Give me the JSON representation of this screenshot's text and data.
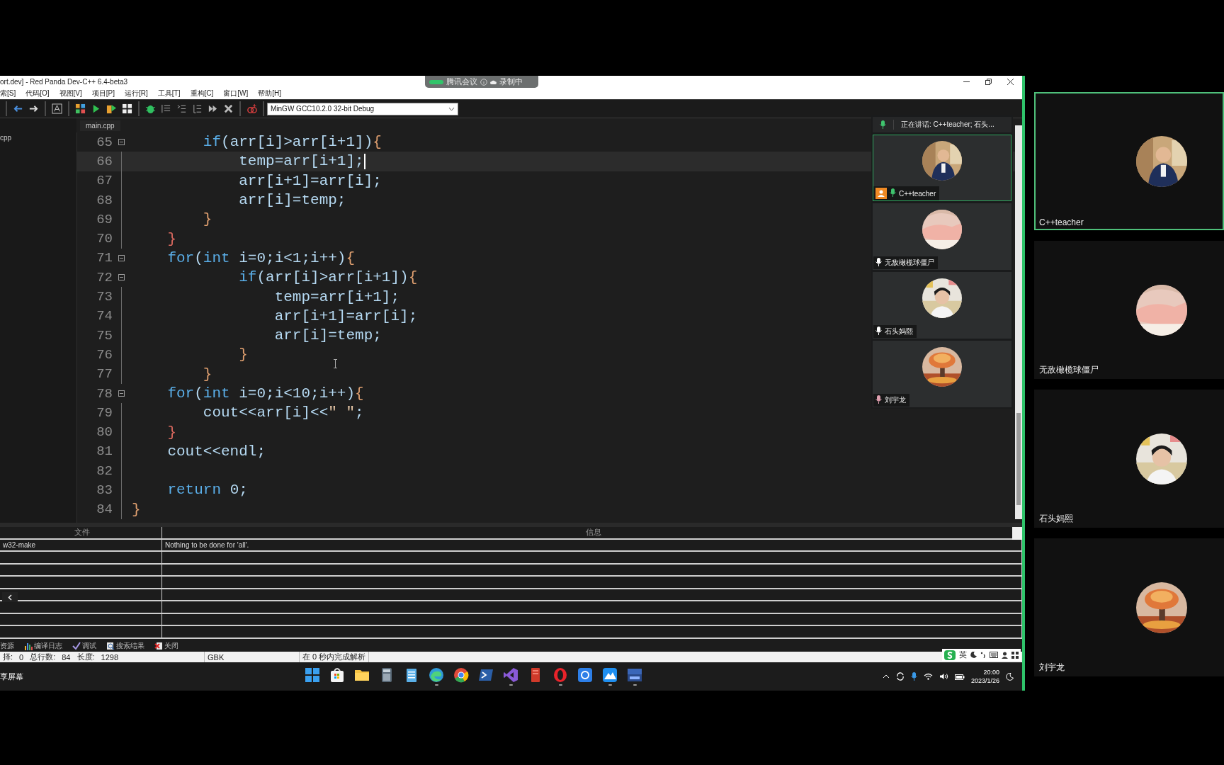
{
  "window": {
    "title": "ort.dev] - Red Panda Dev-C++ 6.4-beta3"
  },
  "recording_pill": {
    "app": "腾讯会议",
    "status": "录制中"
  },
  "menu": [
    "索[S]",
    "代码[O]",
    "视图[V]",
    "项目[P]",
    "运行[R]",
    "工具[T]",
    "重构[C]",
    "窗口[W]",
    "帮助[H]"
  ],
  "toolbar": {
    "compiler": "MinGW GCC10.2.0 32-bit Debug"
  },
  "project_panel": {
    "item": "cpp"
  },
  "editor": {
    "tab": "main.cpp",
    "lines": [
      {
        "number": "65",
        "fold": true,
        "current": false,
        "tokens": [
          {
            "kind": "kw",
            "text": "        if"
          },
          {
            "kind": "id",
            "text": "(arr[i]>arr[i+1])"
          },
          {
            "kind": "brace",
            "text": "{"
          }
        ]
      },
      {
        "number": "66",
        "fold": false,
        "current": true,
        "tokens": [
          {
            "kind": "id",
            "text": "            temp=arr[i+1];"
          }
        ]
      },
      {
        "number": "67",
        "fold": false,
        "current": false,
        "tokens": [
          {
            "kind": "id",
            "text": "            arr[i+1]=arr[i];"
          }
        ]
      },
      {
        "number": "68",
        "fold": false,
        "current": false,
        "tokens": [
          {
            "kind": "id",
            "text": "            arr[i]=temp;"
          }
        ]
      },
      {
        "number": "69",
        "fold": false,
        "current": false,
        "tokens": [
          {
            "kind": "brace",
            "text": "        }"
          }
        ]
      },
      {
        "number": "70",
        "fold": false,
        "current": false,
        "tokens": [
          {
            "kind": "brace2",
            "text": "    }"
          }
        ]
      },
      {
        "number": "71",
        "fold": true,
        "current": false,
        "tokens": [
          {
            "kind": "kw",
            "text": "    for"
          },
          {
            "kind": "id",
            "text": "("
          },
          {
            "kind": "kw",
            "text": "int"
          },
          {
            "kind": "id",
            "text": " i=0;i<1;i++)"
          },
          {
            "kind": "brace",
            "text": "{"
          }
        ]
      },
      {
        "number": "72",
        "fold": true,
        "current": false,
        "tokens": [
          {
            "kind": "kw",
            "text": "            if"
          },
          {
            "kind": "id",
            "text": "(arr[i]>arr[i+1])"
          },
          {
            "kind": "brace",
            "text": "{"
          }
        ]
      },
      {
        "number": "73",
        "fold": false,
        "current": false,
        "tokens": [
          {
            "kind": "id",
            "text": "                temp=arr[i+1];"
          }
        ]
      },
      {
        "number": "74",
        "fold": false,
        "current": false,
        "tokens": [
          {
            "kind": "id",
            "text": "                arr[i+1]=arr[i];"
          }
        ]
      },
      {
        "number": "75",
        "fold": false,
        "current": false,
        "tokens": [
          {
            "kind": "id",
            "text": "                arr[i]=temp;"
          }
        ]
      },
      {
        "number": "76",
        "fold": false,
        "current": false,
        "tokens": [
          {
            "kind": "brace",
            "text": "            }"
          }
        ]
      },
      {
        "number": "77",
        "fold": false,
        "current": false,
        "tokens": [
          {
            "kind": "brace",
            "text": "        }"
          }
        ]
      },
      {
        "number": "78",
        "fold": true,
        "current": false,
        "tokens": [
          {
            "kind": "kw",
            "text": "    for"
          },
          {
            "kind": "id",
            "text": "("
          },
          {
            "kind": "kw",
            "text": "int"
          },
          {
            "kind": "id",
            "text": " i=0;i<10;i++)"
          },
          {
            "kind": "brace",
            "text": "{"
          }
        ]
      },
      {
        "number": "79",
        "fold": false,
        "current": false,
        "tokens": [
          {
            "kind": "id",
            "text": "        cout<<arr[i]<<"
          },
          {
            "kind": "str",
            "text": "\" \""
          },
          {
            "kind": "id",
            "text": ";"
          }
        ]
      },
      {
        "number": "80",
        "fold": false,
        "current": false,
        "tokens": [
          {
            "kind": "brace2",
            "text": "    }"
          }
        ]
      },
      {
        "number": "81",
        "fold": false,
        "current": false,
        "tokens": [
          {
            "kind": "id",
            "text": "    cout<<endl;"
          }
        ]
      },
      {
        "number": "82",
        "fold": false,
        "current": false
      },
      {
        "number": "83",
        "fold": false,
        "current": false,
        "tokens": [
          {
            "kind": "kw",
            "text": "    return"
          },
          {
            "kind": "id",
            "text": " 0;"
          }
        ]
      },
      {
        "number": "84",
        "fold": false,
        "current": false,
        "tokens": [
          {
            "kind": "brace",
            "text": "}"
          }
        ]
      }
    ]
  },
  "meeting_overlay": {
    "speaking": "正在讲话: C++teacher; 石头...",
    "tiles": [
      {
        "name": "C++teacher",
        "speaking": true,
        "host": true,
        "muted": false
      },
      {
        "name": "无敌橄榄球僵尸",
        "speaking": false,
        "host": false,
        "muted": false
      },
      {
        "name": "石头妈熙",
        "speaking": false,
        "host": false,
        "muted": false
      },
      {
        "name": "刘宇龙",
        "speaking": false,
        "host": false,
        "muted": true
      }
    ]
  },
  "messages": {
    "columns": [
      "文件",
      "信息"
    ],
    "rows": [
      [
        "w32-make",
        "Nothing to be done for 'all'."
      ]
    ]
  },
  "bottom_tabs": [
    {
      "kind": "resource",
      "label": "资源"
    },
    {
      "kind": "log",
      "label": "编译日志"
    },
    {
      "kind": "debug",
      "label": "调试"
    },
    {
      "kind": "search",
      "label": "搜索结果"
    },
    {
      "kind": "close",
      "label": "关闭"
    }
  ],
  "status_bar": {
    "selection_label": "择:",
    "selection": "0",
    "lines_label": "总行数:",
    "lines": "84",
    "length_label": "长度:",
    "length": "1298",
    "encoding": "GBK",
    "parse": "在 0 秒内完成解析"
  },
  "ime": {
    "lang": "英"
  },
  "taskbar": {
    "share": "享屏幕",
    "apps": [
      {
        "kind": "windows",
        "running": false
      },
      {
        "kind": "store",
        "running": false
      },
      {
        "kind": "folder",
        "running": false
      },
      {
        "kind": "calculator",
        "running": false
      },
      {
        "kind": "notepad",
        "running": false
      },
      {
        "kind": "edge",
        "running": true
      },
      {
        "kind": "chrome",
        "running": false
      },
      {
        "kind": "terminal",
        "running": false
      },
      {
        "kind": "vs",
        "running": true
      },
      {
        "kind": "book",
        "running": false
      },
      {
        "kind": "opera",
        "running": true
      },
      {
        "kind": "meeting",
        "running": false
      },
      {
        "kind": "cloud",
        "running": true
      },
      {
        "kind": "devcpp",
        "running": true
      }
    ],
    "time": "20:00",
    "date": "2023/1/26"
  },
  "gallery": [
    {
      "name": "C++teacher",
      "speaking": true
    },
    {
      "name": "无敌橄榄球僵尸",
      "speaking": false
    },
    {
      "name": "石头妈熙",
      "speaking": false
    },
    {
      "name": "刘宇龙",
      "speaking": false
    }
  ]
}
